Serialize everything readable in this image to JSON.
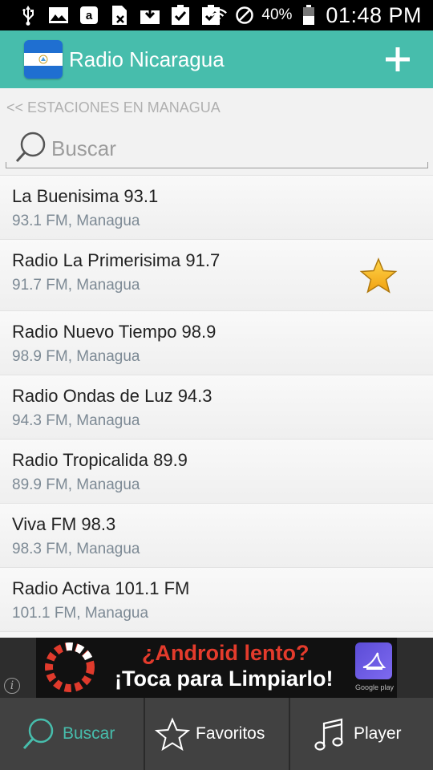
{
  "status_bar": {
    "battery_percent": "40%",
    "time": "01:48 PM",
    "icons": [
      "usb-icon",
      "image-icon",
      "amazon-icon",
      "sim-icon",
      "download-icon",
      "clipboard-check-icon",
      "clipboard-check-icon",
      "wifi-icon",
      "blocked-icon",
      "battery-icon"
    ]
  },
  "app_bar": {
    "title": "Radio Nicaragua",
    "add_icon": "plus-icon"
  },
  "breadcrumb": "<< ESTACIONES EN MANAGUA",
  "search": {
    "placeholder": "Buscar",
    "value": ""
  },
  "stations": [
    {
      "name": "La Buenisima 93.1",
      "detail": "93.1 FM, Managua",
      "favorite": false
    },
    {
      "name": "Radio La Primerisima 91.7",
      "detail": "91.7 FM, Managua",
      "favorite": true
    },
    {
      "name": "Radio Nuevo Tiempo 98.9",
      "detail": "98.9 FM, Managua",
      "favorite": false
    },
    {
      "name": "Radio Ondas de Luz 94.3",
      "detail": "94.3 FM, Managua",
      "favorite": false
    },
    {
      "name": "Radio Tropicalida 89.9",
      "detail": "89.9 FM, Managua",
      "favorite": false
    },
    {
      "name": "Viva FM 98.3",
      "detail": "98.3 FM, Managua",
      "favorite": false
    },
    {
      "name": "Radio Activa 101.1 FM",
      "detail": "101.1 FM, Managua",
      "favorite": false
    }
  ],
  "ad": {
    "line1": "¿Android lento?",
    "line2": "¡Toca para Limpiarlo!",
    "badge": "Google play"
  },
  "tabs": [
    {
      "label": "Buscar",
      "icon": "search-icon",
      "active": true
    },
    {
      "label": "Favoritos",
      "icon": "star-outline-icon",
      "active": false
    },
    {
      "label": "Player",
      "icon": "music-note-icon",
      "active": false
    }
  ],
  "colors": {
    "accent": "#47bdac",
    "status_bar": "#000000",
    "tab_bar": "#414141",
    "star": "#f5b21a"
  }
}
